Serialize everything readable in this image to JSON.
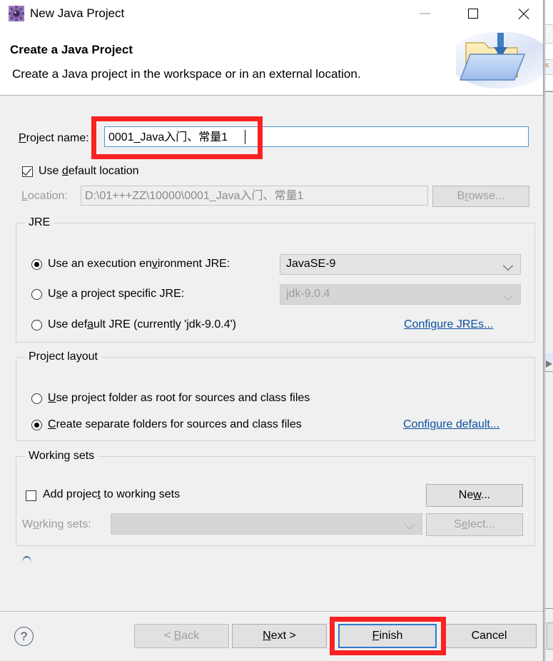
{
  "window": {
    "title": "New Java Project",
    "icon": "java-project-gear-icon",
    "minimize_label": "Minimize",
    "maximize_label": "Maximize",
    "close_label": "Close"
  },
  "header": {
    "title": "Create a Java Project",
    "description": "Create a Java project in the workspace or in an external location.",
    "banner_icon": "new-java-project-folder-icon"
  },
  "project_name": {
    "label": "Project name:",
    "value": "0001_Java入门、常量1"
  },
  "location": {
    "use_default_label": "Use default location",
    "use_default_checked": true,
    "label": "Location:",
    "value": "D:\\01+++ZZ\\10000\\0001_Java入门、常量1",
    "browse_label": "Browse..."
  },
  "jre": {
    "group_title": "JRE",
    "option_execution_env": "Use an execution environment JRE:",
    "execution_env_value": "JavaSE-9",
    "option_project_specific": "Use a project specific JRE:",
    "project_specific_value": "jdk-9.0.4",
    "option_default": "Use default JRE (currently 'jdk-9.0.4')",
    "configure_link": "Configure JREs...",
    "selected": "execution_env"
  },
  "project_layout": {
    "group_title": "Project layout",
    "option_project_folder": "Use project folder as root for sources and class files",
    "option_separate_folders": "Create separate folders for sources and class files",
    "configure_link": "Configure default...",
    "selected": "separate_folders"
  },
  "working_sets": {
    "group_title": "Working sets",
    "add_label": "Add project to working sets",
    "add_checked": false,
    "sets_label": "Working sets:",
    "sets_value": "",
    "new_label": "New...",
    "select_label": "Select..."
  },
  "footer": {
    "help_glyph": "?",
    "back_label": "< Back",
    "next_label": "Next >",
    "finish_label": "Finish",
    "cancel_label": "Cancel",
    "back_disabled": true,
    "finish_focused": true
  },
  "annotations": {
    "color": "#fb2222",
    "highlight_1": "project-name-field",
    "highlight_2": "finish-button"
  }
}
